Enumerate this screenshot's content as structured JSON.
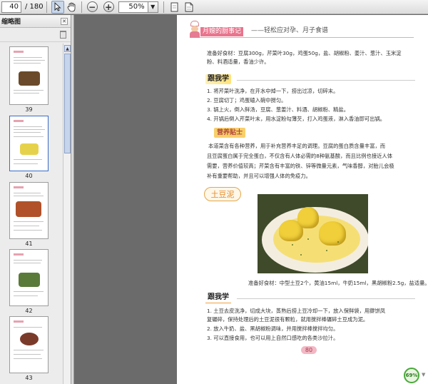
{
  "toolbar": {
    "page_current": "40",
    "page_total": "/ 180",
    "zoom_value": "50%",
    "icons": [
      "select-text-icon",
      "hand-icon",
      "zoom-out-icon",
      "zoom-in-icon",
      "page-icon",
      "document-icon"
    ]
  },
  "sidebar": {
    "title": "缩略图",
    "thumbnails": [
      {
        "label": "39"
      },
      {
        "label": "40"
      },
      {
        "label": "41"
      },
      {
        "label": "42"
      },
      {
        "label": "43"
      }
    ]
  },
  "page": {
    "header_title": "月嫂的厨事记",
    "header_sub": "——轻松应对孕、月子食谱",
    "ingredients_1": "准备好食材：豆腐300g，芹菜叶30g，鸡蛋50g，盐、胡椒粉、姜汁、葱汁、玉米淀",
    "ingredients_1b": "粉、料酒适量，香油少许。",
    "section_learn": "跟我学",
    "steps_1": [
      "1. 将芹菜叶洗净，在开水中焯一下，捞出过凉，切碎末。",
      "2. 豆腐切丁；鸡蛋磕入碗中搅匀。",
      "3. 锅上火，倒入鲜汤，豆腐、葱姜汁、料酒、胡椒粉、精盐。",
      "4. 开锅后倒入芹菜叶末，用水淀粉勾薄芡，打入鸡蛋液，淋入香油即可出锅。"
    ],
    "tip_tag": "营养贴士",
    "tip_lines": [
      "本道菜含有各种营养，用于补充营养丰足的调理。豆腐的蛋白质含量丰富，而",
      "且豆腐蛋白属于完全蛋白，不仅含有人体必需的8种氨基酸，而且比例也接近人体",
      "需要，营养价值较高；芹菜含有丰富的铁、锌等微量元素，气味香醇，对胎儿会极",
      "补有重要帮助，并且可以增强人体的免疫力。"
    ],
    "dish_title": "土豆泥",
    "ingredients_2": "准备好食材：中型土豆2个，黄油15ml，牛奶15ml，黑胡椒粉2.5g，盐适量。",
    "section_learn_2": "跟我学",
    "steps_2": [
      "1. 土豆去皮洗净，切成大块，蒸熟后捞上豆冷却一下，放入保鲜袋，用擀饼凤",
      "   复碾碎，保持处理后的土豆泥很有颗粒，就用搅拌棒碾碎土豆成为泥。",
      "2. 放入牛奶、盐、黑胡椒粉调味，并用搅拌棒搅拌均匀。",
      "3. 可以直接食用，也可以用上自然口感吃的各类沙拉汁。"
    ],
    "page_number": "80",
    "zoom_badge": "69%"
  },
  "colors": {
    "header_pink": "#e9748d",
    "section_yellow": "#ffe27a",
    "dish_orange": "#e28a2a"
  }
}
